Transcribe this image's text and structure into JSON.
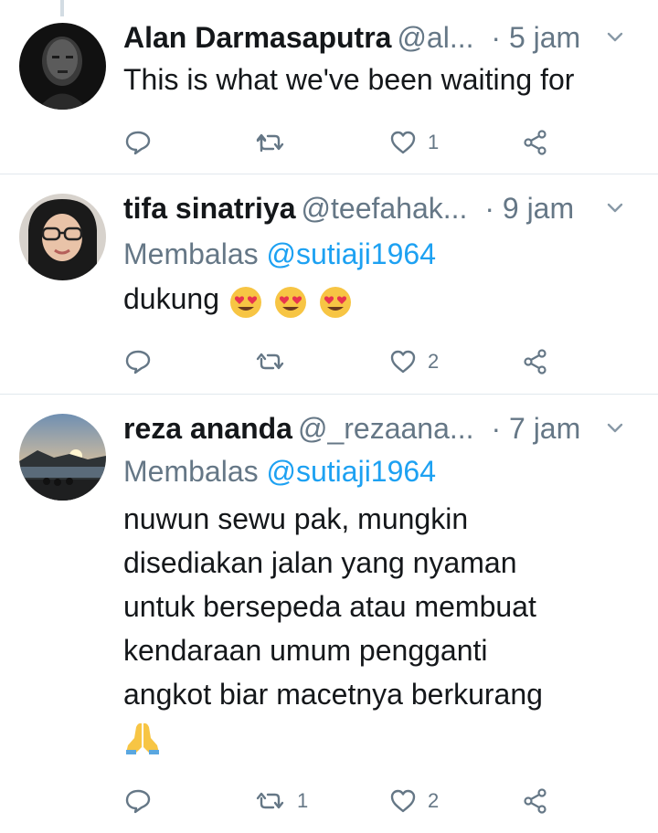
{
  "tweets": [
    {
      "name": "Alan Darmasaputra",
      "handle": "@al...",
      "time": "· 5 jam",
      "text": "This is what we've been waiting for",
      "reply_count": "",
      "retweet_count": "",
      "like_count": "1"
    },
    {
      "name": "tifa sinatriya",
      "handle": "@teefahak...",
      "time": "· 9 jam",
      "reply_prefix": "Membalas",
      "reply_mention": "@sutiaji1964",
      "text": "dukung",
      "emoji": [
        "heart-eyes-emoji",
        "heart-eyes-emoji",
        "heart-eyes-emoji"
      ],
      "reply_count": "",
      "retweet_count": "",
      "like_count": "2"
    },
    {
      "name": "reza ananda",
      "handle": "@_rezaana...",
      "time": "· 7 jam",
      "reply_prefix": "Membalas",
      "reply_mention": "@sutiaji1964",
      "text_lines": [
        "nuwun sewu pak, mungkin",
        "disediakan jalan yang nyaman",
        "untuk bersepeda atau membuat",
        "kendaraan umum pengganti",
        "angkot biar macetnya berkurang"
      ],
      "emoji": [
        "folded-hands-emoji"
      ],
      "reply_count": "",
      "retweet_count": "1",
      "like_count": "2"
    }
  ],
  "colors": {
    "text": "#14171a",
    "secondary": "#657786",
    "link": "#1da1f2",
    "divider": "#e1e8ed"
  },
  "icons": [
    "reply-icon",
    "retweet-icon",
    "like-icon",
    "share-icon",
    "chevron-down-icon"
  ]
}
